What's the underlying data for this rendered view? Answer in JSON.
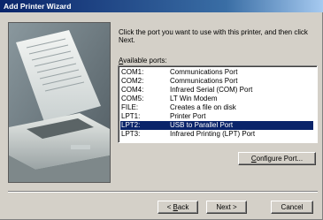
{
  "window": {
    "title": "Add Printer Wizard"
  },
  "instruction": "Click the port you want to use with this printer, and then click Next.",
  "ports_label": {
    "accel": "A",
    "rest": "vailable ports:"
  },
  "ports": [
    {
      "port": "COM1:",
      "description": "Communications Port",
      "selected": false
    },
    {
      "port": "COM2:",
      "description": "Communications Port",
      "selected": false
    },
    {
      "port": "COM4:",
      "description": "Infrared Serial (COM) Port",
      "selected": false
    },
    {
      "port": "COM5:",
      "description": "LT Win Modem",
      "selected": false
    },
    {
      "port": "FILE:",
      "description": "Creates a file on disk",
      "selected": false
    },
    {
      "port": "LPT1:",
      "description": "Printer Port",
      "selected": false
    },
    {
      "port": "LPT2:",
      "description": "USB to Parallel Port",
      "selected": true
    },
    {
      "port": "LPT3:",
      "description": "Infrared Printing (LPT) Port",
      "selected": false
    }
  ],
  "buttons": {
    "configure": {
      "accel": "C",
      "rest": "onfigure Port..."
    },
    "back": {
      "prefix": "< ",
      "accel": "B",
      "rest": "ack"
    },
    "next": "Next >",
    "cancel": "Cancel"
  },
  "colors": {
    "title_bar": "#0a246a",
    "selection": "#0a246a",
    "face": "#d4d0c8"
  }
}
